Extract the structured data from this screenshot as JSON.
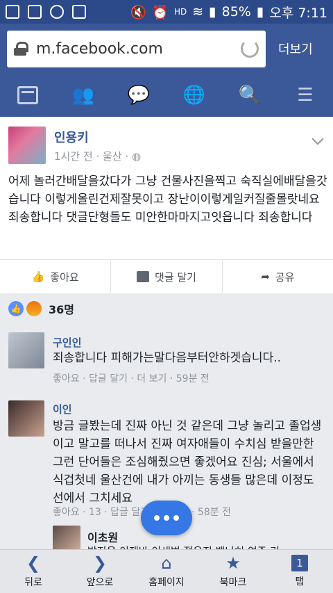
{
  "status_bar": {
    "battery": "85%",
    "time": "오후 7:11",
    "network": "HD"
  },
  "browser": {
    "url": "m.facebook.com",
    "more_label": "더보기"
  },
  "post": {
    "author": "인용키",
    "meta": "1시간 전 · 울산 ·",
    "body": "어제 놀러간배달을갔다가 그냥 건물사진을찍고 숙직실에배달을갓습니다 이렇게올린건제잘못이고 장난이이렇게일커질줄몰랏네요 죄송합니다 댓글단형들도 미안한마마지고잇읍니다 죄송합니다",
    "actions": {
      "like": "좋아요",
      "comment": "댓글 달기",
      "share": "공유"
    }
  },
  "reactions": {
    "count": "36명"
  },
  "comments": [
    {
      "author": "구인인",
      "text": "죄송합니다 피해가는말다음부터안하겟습니다..",
      "meta": "좋아요 · 답글 달기 · 더 보기 · 59분 전"
    },
    {
      "author": "이인",
      "text": "방금 글봤는데 진짜 아닌 것 같은데 그냥 놀리고 졸업생이고 말고를 떠나서 진짜 여자애들이 수치심 받을만한 그런 단어들은 조심해줬으면 좋겠어요 진심; 서울에서 식겁첫네 울산건에 내가 아끼는 동생들 많은데 이정도 선에서 그치세요",
      "meta": "좋아요 · 13 · 답글 달기 · 더 보기 · 58분 전"
    },
    {
      "author": "이초원",
      "text": "방지용 이제바 이새벽 정유진 밴나혀 여주 기",
      "meta": ""
    }
  ],
  "bottom_bar": {
    "back": "뒤로",
    "forward": "앞으로",
    "home": "홈페이지",
    "bookmark": "북마크",
    "tabs": "탭",
    "tab_count": "1"
  }
}
